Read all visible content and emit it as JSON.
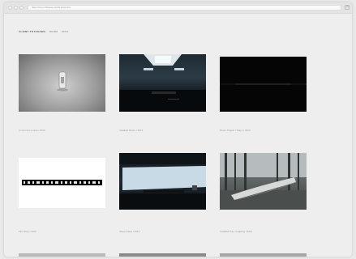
{
  "browser": {
    "url": "https://ssu-ichikawa-studio.jp/works/"
  },
  "site": {
    "brand": "CLIENT TOYAKAWA",
    "nav": [
      "WORK",
      "INFO"
    ]
  },
  "works": [
    {
      "caption": "A room for a vase / 2013"
    },
    {
      "caption": "Installed Room / 2013"
    },
    {
      "caption": "Room Project / Tokyo / 2013"
    },
    {
      "caption": "Film Strip / 2012"
    },
    {
      "caption": "Wave Glass / 2012"
    },
    {
      "caption": "Installed Tree / Lighting / 2012"
    }
  ],
  "colors": {
    "page_bg": "#eeeeee",
    "caption": "#9a9a9a",
    "brand": "#555555"
  }
}
